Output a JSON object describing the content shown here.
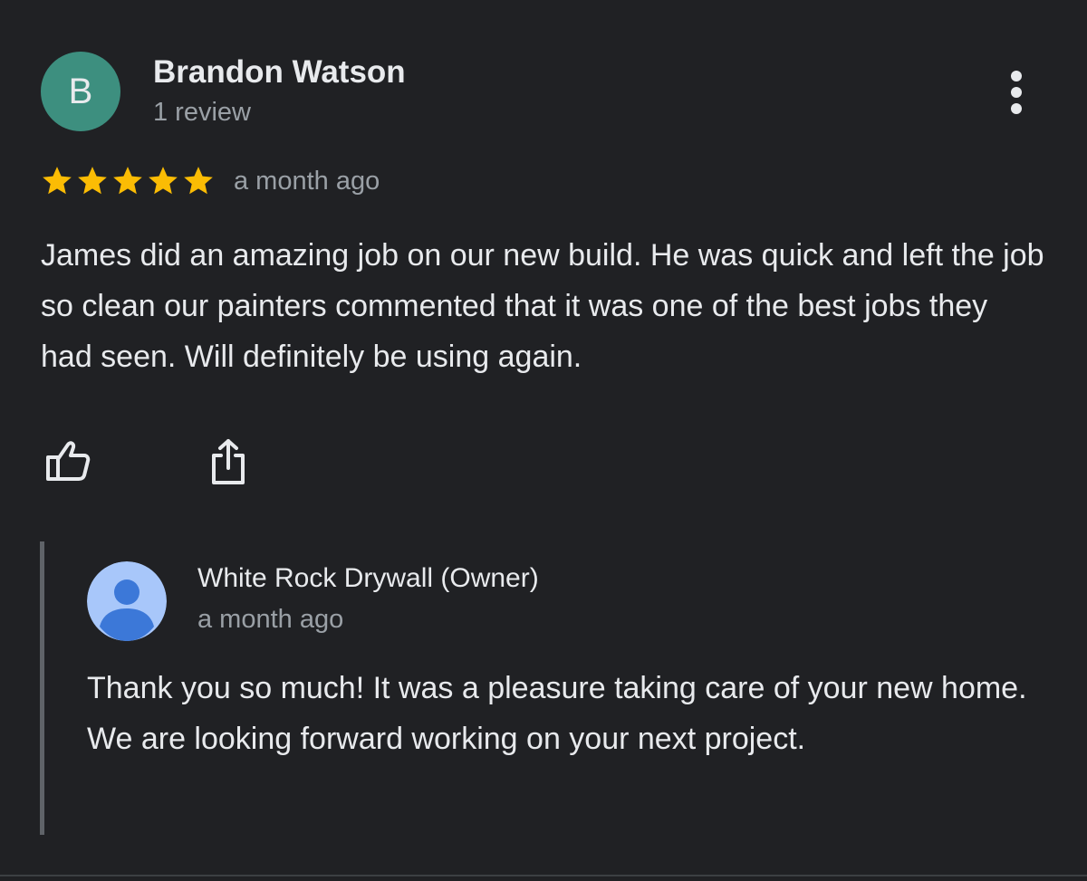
{
  "review": {
    "author": {
      "initial": "B",
      "name": "Brandon Watson",
      "meta": "1 review",
      "avatar_color": "#3d8f7f"
    },
    "rating": 5,
    "max_rating": 5,
    "star_color": "#fbbc04",
    "date": "a month ago",
    "text": "James did an amazing job on our new build. He was quick and left the job so clean our painters commented that it was one of the best jobs they had seen. Will definitely be using again.",
    "actions": {
      "like_icon": "thumbs-up-icon",
      "share_icon": "share-icon",
      "more_icon": "more-vertical-icon"
    }
  },
  "owner_response": {
    "name": "White Rock Drywall (Owner)",
    "date": "a month ago",
    "text": "Thank you so much! It was a pleasure taking care of your new home. We are looking forward working on your next project.",
    "avatar_icon": "default-profile-icon",
    "avatar_bg": "#a8c7fa",
    "avatar_fg": "#3c78d8"
  },
  "colors": {
    "background": "#202124",
    "primary_text": "#e8eaed",
    "secondary_text": "#9aa0a6"
  }
}
